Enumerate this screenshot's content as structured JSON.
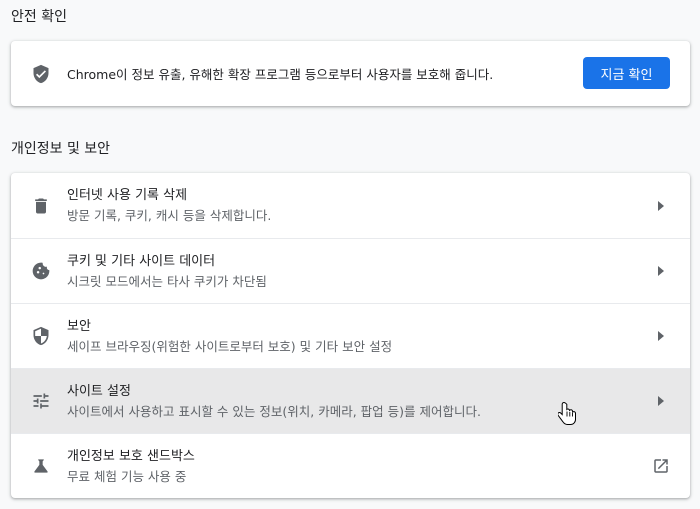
{
  "safety": {
    "heading": "안전 확인",
    "description": "Chrome이 정보 유출, 유해한 확장 프로그램 등으로부터 사용자를 보호해 줍니다.",
    "check_button": "지금 확인"
  },
  "privacy": {
    "heading": "개인정보 및 보안",
    "items": [
      {
        "title": "인터넷 사용 기록 삭제",
        "subtitle": "방문 기록, 쿠키, 캐시 등을 삭제합니다.",
        "icon": "trash-icon"
      },
      {
        "title": "쿠키 및 기타 사이트 데이터",
        "subtitle": "시크릿 모드에서는 타사 쿠키가 차단됨",
        "icon": "cookie-icon"
      },
      {
        "title": "보안",
        "subtitle": "세이프 브라우징(위험한 사이트로부터 보호) 및 기타 보안 설정",
        "icon": "shield-icon"
      },
      {
        "title": "사이트 설정",
        "subtitle": "사이트에서 사용하고 표시할 수 있는 정보(위치, 카메라, 팝업 등)를 제어합니다.",
        "icon": "tune-icon"
      },
      {
        "title": "개인정보 보호 샌드박스",
        "subtitle": "무료 체험 기능 사용 중",
        "icon": "flask-icon"
      }
    ]
  },
  "colors": {
    "accent": "#1a73e8",
    "hover_row": "#e8e8e9",
    "icon": "#5f6368"
  }
}
